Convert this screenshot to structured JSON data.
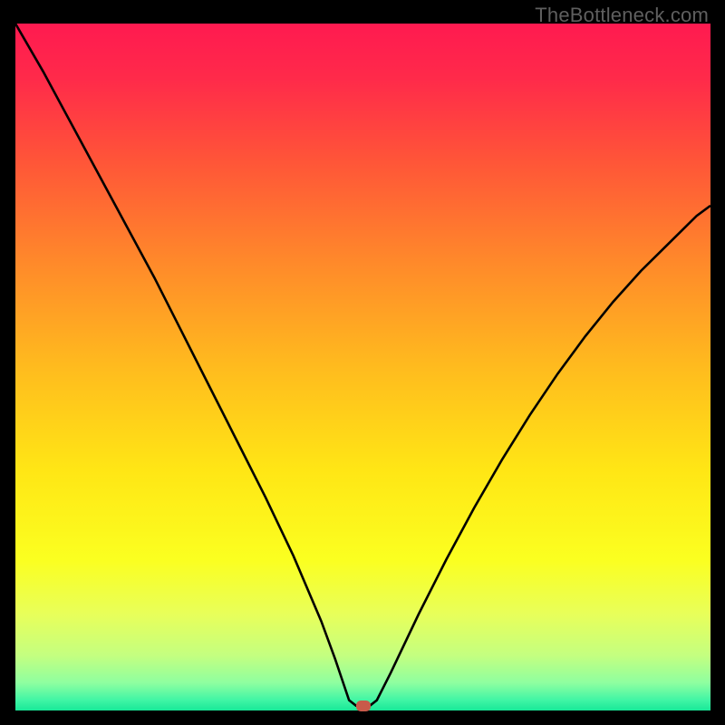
{
  "watermark": "TheBottleneck.com",
  "chart_data": {
    "type": "line",
    "title": "",
    "xlabel": "",
    "ylabel": "",
    "xlim": [
      0,
      100
    ],
    "ylim": [
      0,
      100
    ],
    "x": [
      0,
      4,
      8,
      12,
      16,
      20,
      24,
      28,
      32,
      36,
      40,
      44,
      46,
      47,
      48,
      49,
      50,
      51,
      52,
      54,
      58,
      62,
      66,
      70,
      74,
      78,
      82,
      86,
      90,
      94,
      98,
      100
    ],
    "values": [
      100,
      93,
      85.5,
      78,
      70.5,
      63,
      55,
      47,
      39,
      31,
      22.5,
      13,
      7.5,
      4.5,
      1.5,
      0.7,
      0.7,
      0.7,
      1.5,
      5.5,
      14,
      22,
      29.5,
      36.5,
      43,
      49,
      54.5,
      59.5,
      64,
      68,
      72,
      73.5
    ],
    "marker": {
      "x": 50,
      "y": 0.7
    },
    "gradient_stops": [
      {
        "offset": 0.0,
        "color": "#ff1a50"
      },
      {
        "offset": 0.08,
        "color": "#ff2a4a"
      },
      {
        "offset": 0.2,
        "color": "#ff5538"
      },
      {
        "offset": 0.35,
        "color": "#ff8a2a"
      },
      {
        "offset": 0.5,
        "color": "#ffbb1e"
      },
      {
        "offset": 0.65,
        "color": "#ffe615"
      },
      {
        "offset": 0.78,
        "color": "#fbff20"
      },
      {
        "offset": 0.86,
        "color": "#e8ff5a"
      },
      {
        "offset": 0.92,
        "color": "#c4ff80"
      },
      {
        "offset": 0.96,
        "color": "#8effa0"
      },
      {
        "offset": 0.985,
        "color": "#40f5a5"
      },
      {
        "offset": 1.0,
        "color": "#18e898"
      }
    ]
  }
}
